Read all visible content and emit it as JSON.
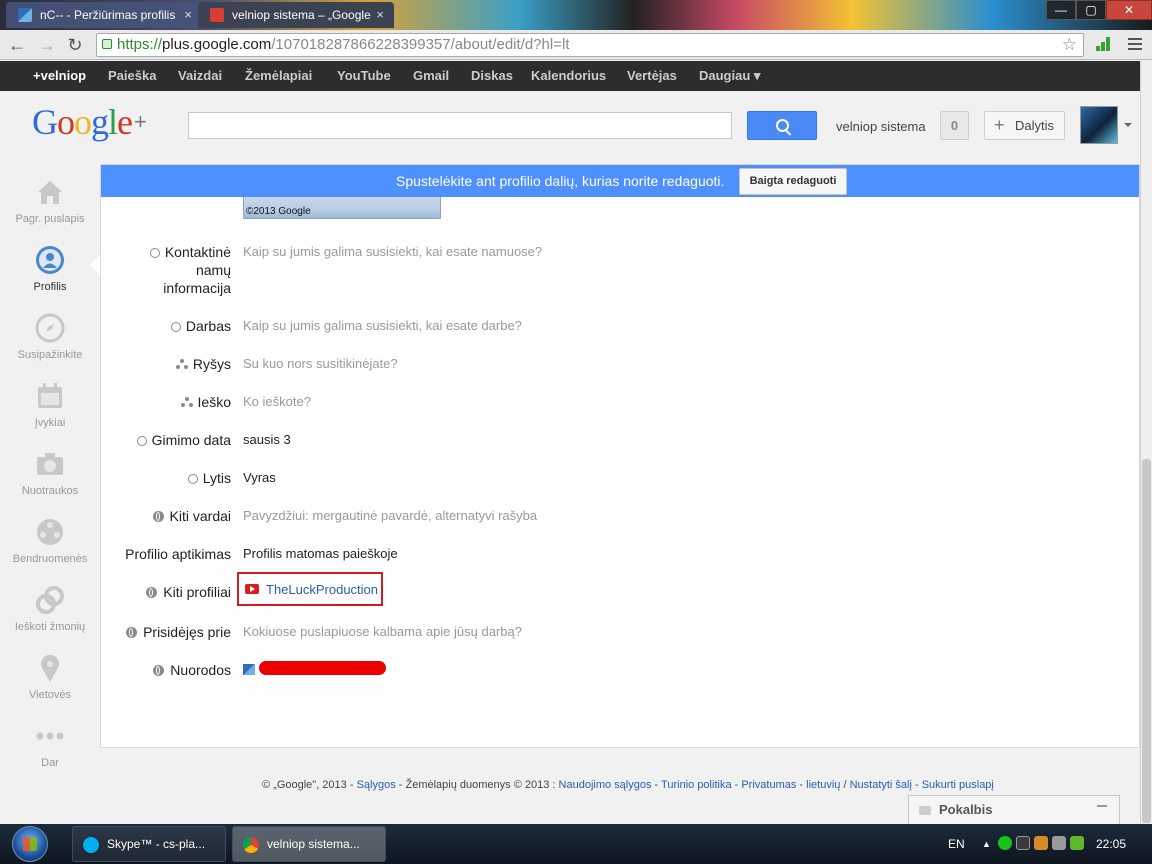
{
  "browser": {
    "tabs": [
      {
        "label": "nC-- - Peržiūrimas profilis"
      },
      {
        "label": "velniop sistema – „Google"
      }
    ],
    "window_controls": {
      "minimize": "—",
      "maximize": "▢",
      "close": "✕"
    },
    "url": {
      "scheme": "https://",
      "host": "plus.google.com",
      "path": "/107018287866228399357/about/edit/d?hl=lt"
    }
  },
  "gbar": {
    "items": [
      "+velniop",
      "Paieška",
      "Vaizdai",
      "Žemėlapiai",
      "YouTube",
      "Gmail",
      "Diskas",
      "Kalendorius",
      "Vertėjas",
      "Daugiau ▾"
    ]
  },
  "header": {
    "username": "velniop sistema",
    "notifications": "0",
    "share_label": "Dalytis"
  },
  "leftnav": {
    "items": [
      {
        "label": "Pagr. puslapis",
        "icon": "home-icon"
      },
      {
        "label": "Profilis",
        "icon": "profile-icon"
      },
      {
        "label": "Susipažinkite",
        "icon": "compass-icon"
      },
      {
        "label": "Įvykiai",
        "icon": "calendar-icon"
      },
      {
        "label": "Nuotraukos",
        "icon": "camera-icon"
      },
      {
        "label": "Bendruomenės",
        "icon": "communities-icon"
      },
      {
        "label": "Ieškoti žmonių",
        "icon": "circles-icon"
      },
      {
        "label": "Vietovės",
        "icon": "pin-icon"
      },
      {
        "label": "Dar",
        "icon": "more-icon"
      }
    ]
  },
  "editbar": {
    "message": "Spustelėkite ant profilio dalių, kurias norite redaguoti.",
    "done_label": "Baigta redaguoti"
  },
  "map": {
    "copyright": "©2013 Google"
  },
  "profile": {
    "rows": [
      {
        "label": "Kontaktinė namų informacija",
        "value": "Kaip su jumis galima susisiekti, kai esate namuose?",
        "icon": "circle-icon"
      },
      {
        "label": "Darbas",
        "value": "Kaip su jumis galima susisiekti, kai esate darbe?",
        "icon": "circle-icon"
      },
      {
        "label": "Ryšys",
        "value": "Su kuo nors susitikinėjate?",
        "icon": "circles-icon"
      },
      {
        "label": "Ieško",
        "value": "Ko ieškote?",
        "icon": "circles-icon"
      },
      {
        "label": "Gimimo data",
        "value": "sausis 3",
        "icon": "circle-icon"
      },
      {
        "label": "Lytis",
        "value": "Vyras",
        "icon": "circle-icon"
      },
      {
        "label": "Kiti vardai",
        "value": "Pavyzdžiui: mergautinė pavardė, alternatyvi rašyba",
        "icon": "globe-icon"
      },
      {
        "label": "Profilio aptikimas",
        "value": "Profilis matomas paieškoje"
      },
      {
        "label": "Kiti profiliai",
        "value": "TheLuckProduction",
        "icon": "globe-icon"
      },
      {
        "label": "Prisidėjęs prie",
        "value": "Kokiuose puslapiuose kalbama apie jūsų darbą?",
        "icon": "globe-icon"
      },
      {
        "label": "Nuorodos",
        "icon": "globe-icon"
      }
    ]
  },
  "footer": {
    "copyright": "© „Google\", 2013 -",
    "terms": "Sąlygos",
    "maps_data": "- Žemėlapių duomenys © 2013 :",
    "usage_terms": "Naudojimo sąlygos",
    "content_policy": "Turinio politika",
    "privacy": "Privatumas",
    "language": "lietuvių",
    "settings": "Nustatyti šalį",
    "create_page": "Sukurti puslapį",
    "sep": " - ",
    "slash": " / "
  },
  "chat": {
    "label": "Pokalbis"
  },
  "taskbar": {
    "buttons": [
      {
        "label": "Skype™ - cs-pla..."
      },
      {
        "label": "velniop sistema..."
      }
    ],
    "lang": "EN",
    "clock": "22:05",
    "tray_up": "▲"
  },
  "colors": {
    "accent": "#4d90fe",
    "highlight_border": "#cc1f1f",
    "youtube_red": "#d91e1e",
    "redaction": "#ee0000"
  }
}
